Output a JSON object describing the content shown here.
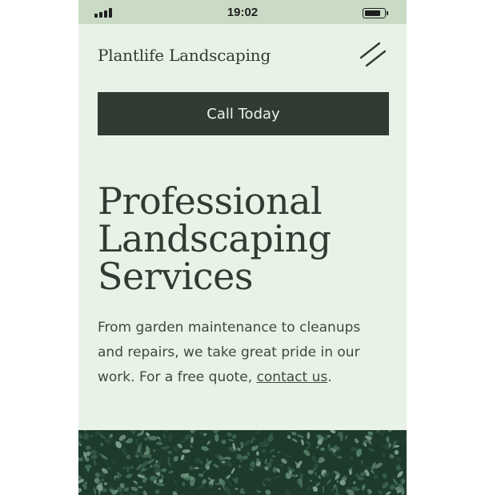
{
  "status_bar": {
    "time": "19:02",
    "signal_bars": 4,
    "battery_level": 0.85
  },
  "header": {
    "brand": "Plantlife Landscaping",
    "menu_icon": "menu-icon"
  },
  "cta": {
    "label": "Call Today"
  },
  "hero": {
    "title_lines": [
      "Professional",
      "Landscaping",
      "Services"
    ],
    "intro_text": "From garden maintenance to cleanups and repairs, we take great pride in our work. For a free quote,",
    "link_text": "contact us",
    "trailing": "."
  },
  "banner": {
    "image_icon": "hedge-foliage-image"
  },
  "colors": {
    "background": "#e9f2e6",
    "status_bar": "#c9dbc5",
    "primary": "#2f3b33",
    "button_text": "#eef4ec",
    "foliage_dark": "#1d3a2c",
    "foliage_mid": "#3f6a54",
    "foliage_light": "#7fa08d"
  }
}
